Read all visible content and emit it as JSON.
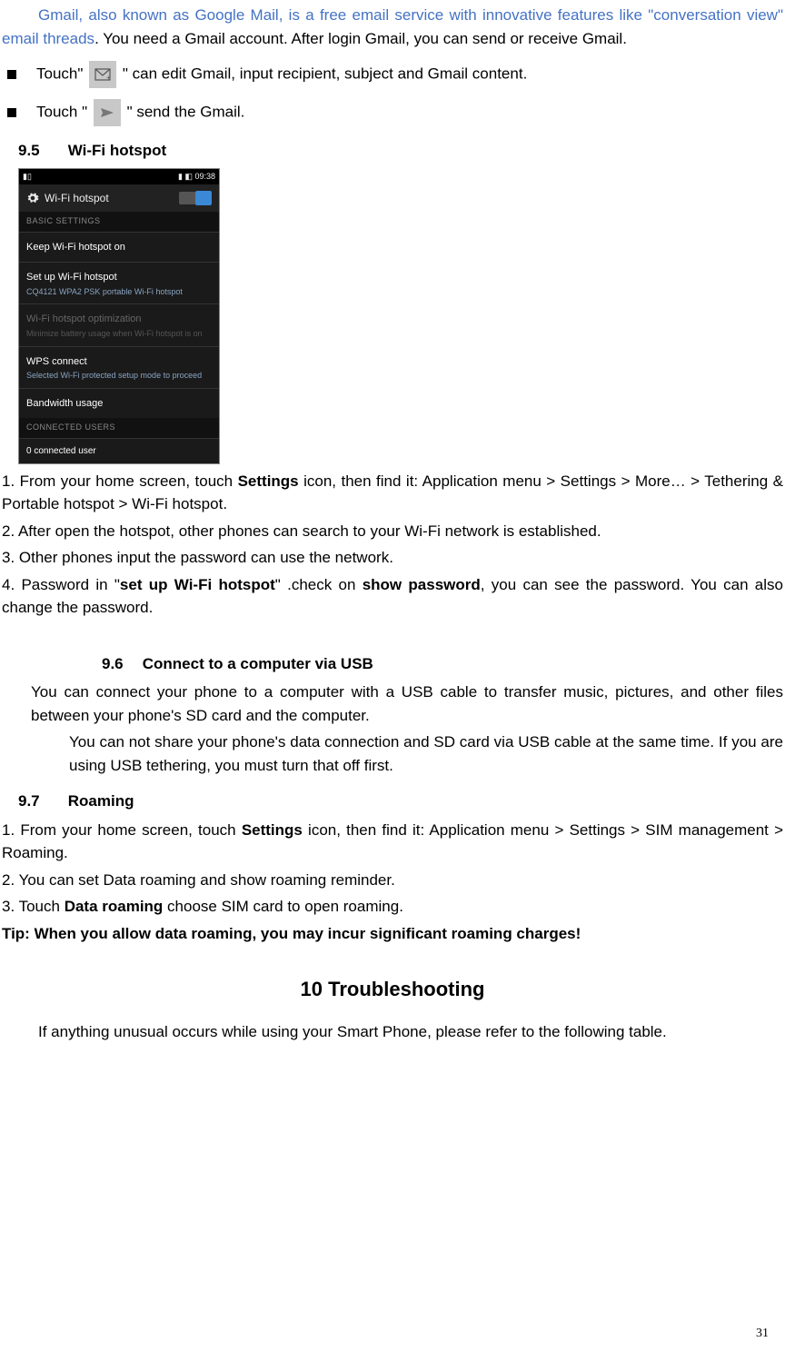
{
  "intro": {
    "line1_blue": "Gmail, also known as Google Mail, is a free email service with innovative features like \"conversation view\" email threads",
    "line1_black": ". You need a Gmail account. After login Gmail, you can send or receive Gmail."
  },
  "bullets": {
    "b1_pre": "Touch\" ",
    "b1_post": "\" can edit Gmail, input recipient, subject and Gmail content.",
    "b2_pre": "Touch \"",
    "b2_post": "\" send the Gmail."
  },
  "sec95": {
    "num": "9.5",
    "title": "Wi-Fi hotspot"
  },
  "screenshot": {
    "signal": "▮▯",
    "time": "09:38",
    "header": "Wi-Fi hotspot",
    "basic": "BASIC SETTINGS",
    "keep": "Keep Wi-Fi hotspot on",
    "setup_t": "Set up Wi-Fi hotspot",
    "setup_s": "CQ4121 WPA2 PSK portable Wi-Fi hotspot",
    "opt_t": "Wi-Fi hotspot optimization",
    "opt_s": "Minimize battery usage when Wi-Fi hotspot is on",
    "wps_t": "WPS connect",
    "wps_s": "Selected Wi-Fi protected setup mode to proceed",
    "bw": "Bandwidth usage",
    "conn": "CONNECTED USERS",
    "zero": "0 connected user"
  },
  "wifi_steps": {
    "s1a": "1. From your home screen, touch ",
    "s1b": "Settings",
    "s1c": " icon, then find it: Application menu > Settings > More… > Tethering & Portable hotspot > Wi-Fi hotspot.",
    "s2": "2. After open the hotspot, other phones can search to your Wi-Fi network is established.",
    "s3": "3. Other phones input the password can use the network.",
    "s4a": "4. Password in \"",
    "s4b": "set up Wi-Fi hotspot",
    "s4c": "\" .check on ",
    "s4d": "show password",
    "s4e": ", you can see the password. You can also change the password."
  },
  "sec96": {
    "num": "9.6",
    "title": "Connect to a computer via USB",
    "p1": "You can connect your phone to a computer with a USB cable to transfer music, pictures, and other files between your phone's SD card and the computer.",
    "p2": "You can not share your phone's data connection and SD card via USB cable at the same time. If you are using USB tethering, you must turn that off first."
  },
  "sec97": {
    "num": "9.7",
    "title": "Roaming",
    "s1a": "1. From your home screen, touch ",
    "s1b": "Settings",
    "s1c": " icon, then find it: Application menu > Settings > SIM management > Roaming.",
    "s2": "2. You can set Data roaming and show roaming reminder.",
    "s3a": "3. Touch ",
    "s3b": "Data roaming",
    "s3c": " choose SIM card to open roaming.",
    "tip": "Tip: When you allow data roaming, you may incur significant roaming charges!"
  },
  "sec10": {
    "title": "10  Troubleshooting",
    "p": "If anything unusual occurs while using your Smart Phone, please refer to the following table."
  },
  "page_num": "31"
}
